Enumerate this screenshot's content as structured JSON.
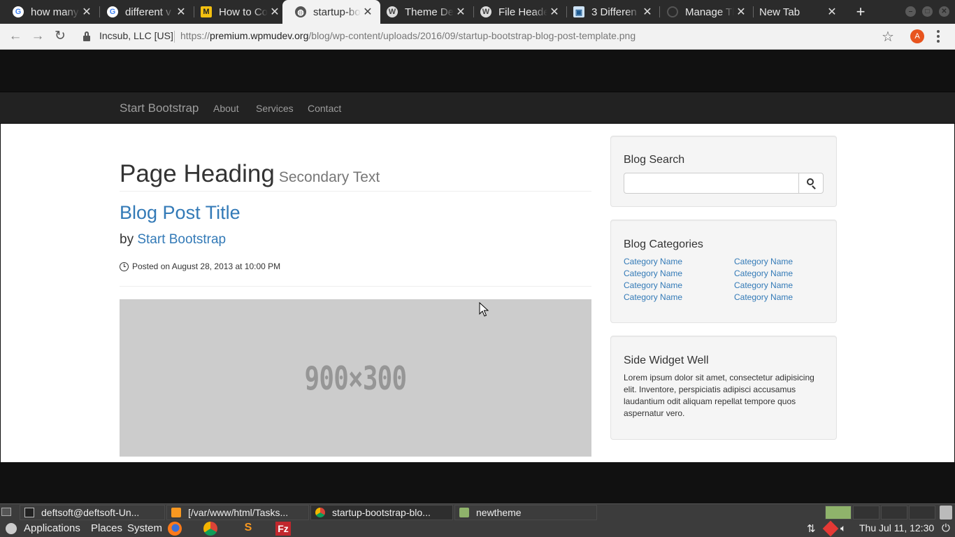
{
  "browser": {
    "tabs": [
      {
        "label": "how many",
        "icon": "google-icon",
        "active": false
      },
      {
        "label": "different v",
        "icon": "google-icon",
        "active": false
      },
      {
        "label": "How to Co",
        "icon": "wpmu-icon",
        "active": false
      },
      {
        "label": "startup-bo",
        "icon": "globe-icon",
        "active": true
      },
      {
        "label": "Theme De",
        "icon": "wordpress-icon",
        "active": false
      },
      {
        "label": "File Heade",
        "icon": "wordpress-icon",
        "active": false
      },
      {
        "label": "3 Differen",
        "icon": "site-icon",
        "active": false
      },
      {
        "label": "Manage Th",
        "icon": "loading-icon",
        "active": false
      },
      {
        "label": "New Tab",
        "icon": "",
        "active": false
      }
    ],
    "site_info": "Incsub, LLC [US]",
    "url_scheme": "https://",
    "url_host": "premium.wpmudev.org",
    "url_path": "/blog/wp-content/uploads/2016/09/startup-bootstrap-blog-post-template.png",
    "account_initial": "A",
    "accent_color": "#e8541e"
  },
  "page": {
    "navbar": {
      "brand": "Start Bootstrap",
      "links": [
        "About",
        "Services",
        "Contact"
      ]
    },
    "heading": "Page Heading",
    "heading_secondary": "Secondary Text",
    "post_title": "Blog Post Title",
    "by_label": "by",
    "author": "Start Bootstrap",
    "posted": "Posted on August 28, 2013 at 10:00 PM",
    "image_placeholder": "900×300",
    "sidebar": {
      "search_title": "Blog Search",
      "categories_title": "Blog Categories",
      "categories_left": [
        "Category Name",
        "Category Name",
        "Category Name",
        "Category Name"
      ],
      "categories_right": [
        "Category Name",
        "Category Name",
        "Category Name",
        "Category Name"
      ],
      "widget_title": "Side Widget Well",
      "widget_text": "Lorem ipsum dolor sit amet, consectetur adipisicing elit. Inventore, perspiciatis adipisci accusamus laudantium odit aliquam repellat tempore quos aspernatur vero."
    },
    "link_color": "#337ab7"
  },
  "taskbar": {
    "tasks": [
      "deftsoft@deftsoft-Un...",
      "[/var/www/html/Tasks...",
      "startup-bootstrap-blo...",
      "newtheme"
    ],
    "menus": [
      "Applications",
      "Places",
      "System"
    ],
    "clock": "Thu Jul 11, 12:30"
  }
}
